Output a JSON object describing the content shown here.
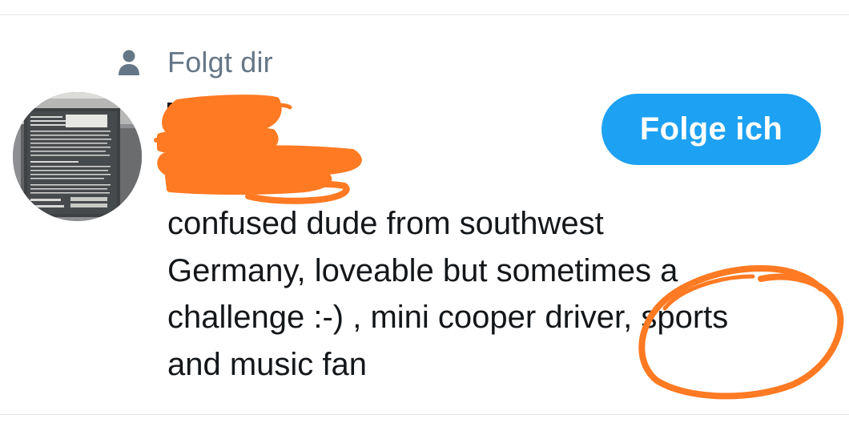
{
  "follows_you_label": "Folgt dir",
  "follow_button_label": "Folge ich",
  "bio": {
    "lines": [
      "confused dude from southwest",
      "Germany, loveable but sometimes a",
      "challenge :-) , mini cooper driver, sports",
      "and music fan"
    ]
  },
  "avatar_poster_text": "THIS IS YOUR LIFE. LIFE IS SHORT.",
  "colors": {
    "follow_button": "#1da1f2",
    "secondary_text": "#657786",
    "primary_text": "#14171a",
    "annotation_marker": "#ff7a22",
    "divider": "#dfe4e8"
  },
  "icons": {
    "follows_indicator": "person-icon"
  }
}
